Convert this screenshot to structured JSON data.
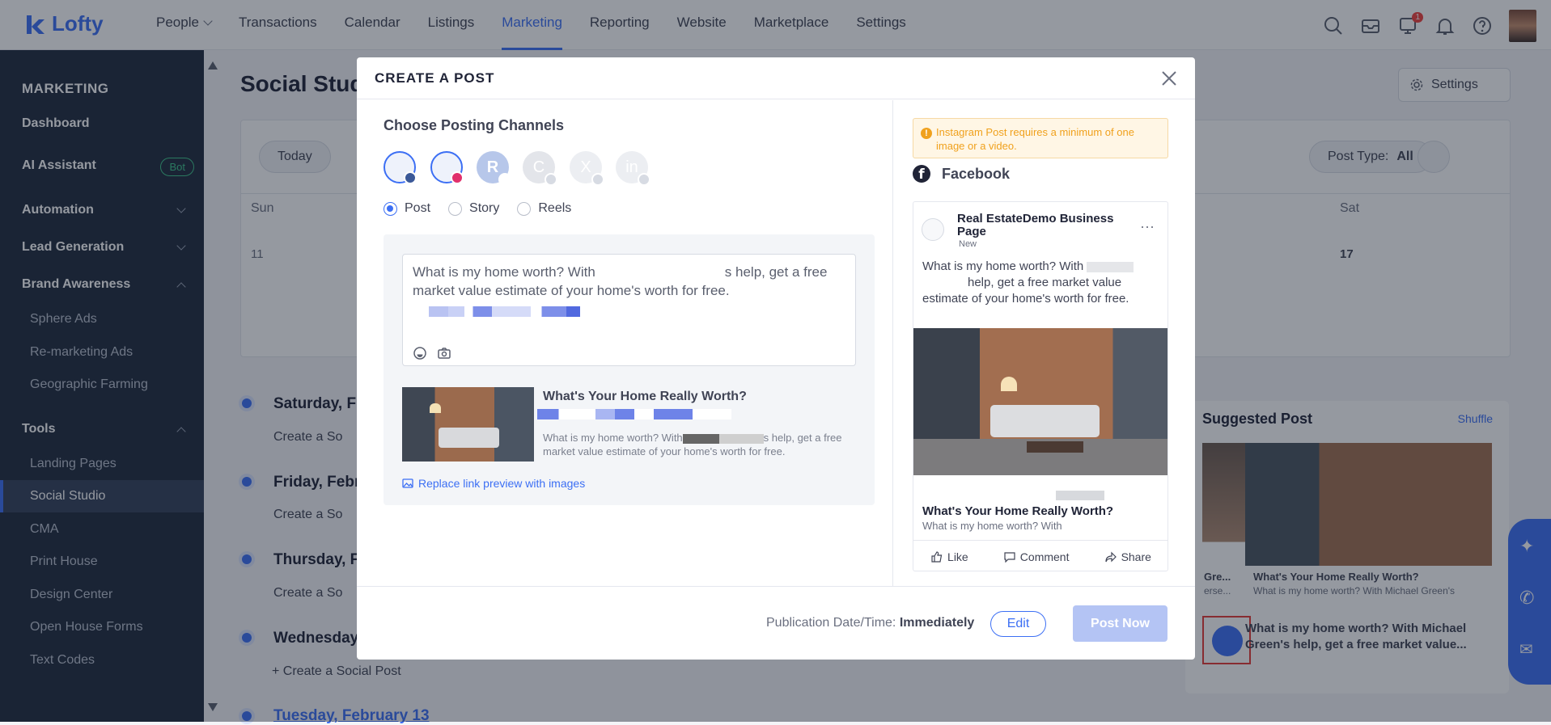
{
  "topnav": {
    "logo": "Lofty",
    "items": [
      "People",
      "Transactions",
      "Calendar",
      "Listings",
      "Marketing",
      "Reporting",
      "Website",
      "Marketplace",
      "Settings"
    ],
    "active": "Marketing",
    "notification_count": "1"
  },
  "sidebar": {
    "title": "MARKETING",
    "dashboard": "Dashboard",
    "ai_assistant": "AI Assistant",
    "bot_badge": "Bot",
    "automation": "Automation",
    "lead_generation": "Lead Generation",
    "brand_awareness": "Brand Awareness",
    "brand_items": [
      "Sphere Ads",
      "Re-marketing Ads",
      "Geographic Farming"
    ],
    "tools": "Tools",
    "tool_items": [
      "Landing Pages",
      "Social Studio",
      "CMA",
      "Print House",
      "Design Center",
      "Open House Forms",
      "Text Codes"
    ],
    "active_item": "Social Studio"
  },
  "page": {
    "title": "Social Studio",
    "today": "Today",
    "settings": "Settings",
    "post_type_label": "Post Type:",
    "post_type_value": "All",
    "sun": "Sun",
    "sat": "Sat",
    "sun_date": "11",
    "sat_date": "17",
    "days": [
      "Saturday, F",
      "Friday, Febr",
      "Thursday, F",
      "Wednesday",
      "Tuesday, February 13"
    ],
    "create_post": "Create a Social Post",
    "create_short": "Create a So",
    "suggested_title": "Suggested Post",
    "shuffle": "Shuffle",
    "suggest_card_title": "What's Your Home Really Worth?",
    "suggest_card_desc": "What is my home worth? With Michael Green's",
    "suggest_side_title": "Gre...",
    "suggest_side_desc": "erse...",
    "suggest_text": "What is my home worth? With Michael Green's help, get a free market value..."
  },
  "modal": {
    "title": "CREATE A POST",
    "choose_channels": "Choose Posting Channels",
    "channel_r": "R",
    "channel_c": "C",
    "channel_x": "X",
    "channel_in": "in",
    "post_types": [
      "Post",
      "Story",
      "Reels"
    ],
    "selected_type": "Post",
    "compose_text_start": "What is my home worth? With",
    "compose_text_end": "s help, get a free market value estimate of your home's worth for free.",
    "link_title": "What's Your Home Really Worth?",
    "link_desc_start": "What is my home worth? With",
    "link_desc_end": "s help, get a free market value estimate of your home's worth for free.",
    "replace_link": "Replace link preview with images",
    "warning": "Instagram Post requires a minimum of one image or a video.",
    "facebook": "Facebook",
    "fb_page_name": "Real EstateDemo Business Page",
    "fb_meta": "New",
    "fb_text_start": "What is my home worth? With",
    "fb_text_end": "help, get a free market value estimate of your home's worth for free.",
    "fb_link_title": "What's Your Home Really Worth?",
    "fb_link_desc": "What is my home worth? With",
    "fb_like": "Like",
    "fb_comment": "Comment",
    "fb_share": "Share",
    "publication_label": "Publication Date/Time:",
    "publication_value": "Immediately",
    "edit": "Edit",
    "post_now": "Post Now"
  },
  "colors": {
    "accent": "#3c6ff4",
    "sidebar": "#1f2a3d",
    "warning": "#f0a11d"
  }
}
